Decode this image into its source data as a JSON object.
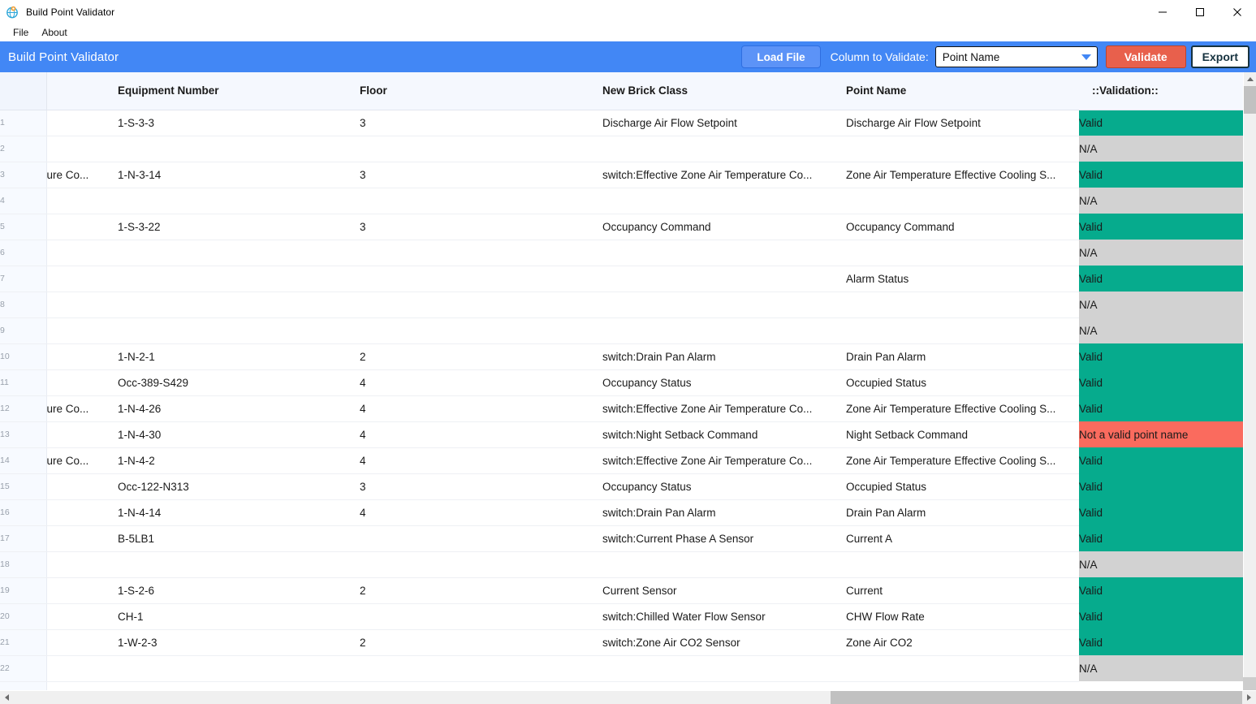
{
  "window": {
    "title": "Build Point Validator",
    "icon": "app-globe-icon",
    "minimize_label": "—",
    "maximize_label": "□",
    "close_label": "✕"
  },
  "menubar": {
    "items": [
      {
        "label": "File"
      },
      {
        "label": "About"
      }
    ]
  },
  "appheader": {
    "title": "Build Point Validator",
    "accent_blue": "#4287f5",
    "load_file_label": "Load File",
    "column_to_validate_label": "Column to Validate:",
    "selected_column": "Point Name",
    "validate_label": "Validate",
    "validate_color": "#e8604c",
    "export_label": "Export"
  },
  "table": {
    "columns": [
      {
        "key": "rownum",
        "label": ""
      },
      {
        "key": "clipped",
        "label": ""
      },
      {
        "key": "equipment_number",
        "label": "Equipment Number"
      },
      {
        "key": "floor",
        "label": "Floor"
      },
      {
        "key": "new_brick_class",
        "label": "New Brick Class"
      },
      {
        "key": "point_name",
        "label": "Point Name"
      },
      {
        "key": "validation",
        "label": "::Validation::"
      }
    ],
    "status_colors": {
      "valid": "#06ab8d",
      "na": "#d2d2d2",
      "invalid": "#fa6b5e"
    },
    "rows": [
      {
        "n": "1",
        "clipped": "",
        "equipment_number": "1-S-3-3",
        "floor": "3",
        "new_brick_class": "Discharge Air Flow Setpoint",
        "point_name": "Discharge Air Flow Setpoint",
        "validation": "Valid",
        "status": "valid"
      },
      {
        "n": "2",
        "clipped": "",
        "equipment_number": "",
        "floor": "",
        "new_brick_class": "",
        "point_name": "",
        "validation": "N/A",
        "status": "na"
      },
      {
        "n": "3",
        "clipped": "ure Co...",
        "equipment_number": "1-N-3-14",
        "floor": "3",
        "new_brick_class": "switch:Effective Zone Air Temperature Co...",
        "point_name": "Zone Air Temperature Effective Cooling S...",
        "validation": "Valid",
        "status": "valid"
      },
      {
        "n": "4",
        "clipped": "",
        "equipment_number": "",
        "floor": "",
        "new_brick_class": "",
        "point_name": "",
        "validation": "N/A",
        "status": "na"
      },
      {
        "n": "5",
        "clipped": "",
        "equipment_number": "1-S-3-22",
        "floor": "3",
        "new_brick_class": "Occupancy Command",
        "point_name": "Occupancy Command",
        "validation": "Valid",
        "status": "valid"
      },
      {
        "n": "6",
        "clipped": "",
        "equipment_number": "",
        "floor": "",
        "new_brick_class": "",
        "point_name": "",
        "validation": "N/A",
        "status": "na"
      },
      {
        "n": "7",
        "clipped": "",
        "equipment_number": "",
        "floor": "",
        "new_brick_class": "",
        "point_name": "Alarm Status",
        "validation": "Valid",
        "status": "valid"
      },
      {
        "n": "8",
        "clipped": "",
        "equipment_number": "",
        "floor": "",
        "new_brick_class": "",
        "point_name": "",
        "validation": "N/A",
        "status": "na"
      },
      {
        "n": "9",
        "clipped": "",
        "equipment_number": "",
        "floor": "",
        "new_brick_class": "",
        "point_name": "",
        "validation": "N/A",
        "status": "na"
      },
      {
        "n": "10",
        "clipped": "",
        "equipment_number": "1-N-2-1",
        "floor": "2",
        "new_brick_class": "switch:Drain Pan Alarm",
        "point_name": "Drain Pan Alarm",
        "validation": "Valid",
        "status": "valid"
      },
      {
        "n": "11",
        "clipped": "",
        "equipment_number": "Occ-389-S429",
        "floor": "4",
        "new_brick_class": "Occupancy Status",
        "point_name": "Occupied Status",
        "validation": "Valid",
        "status": "valid"
      },
      {
        "n": "12",
        "clipped": "ure Co...",
        "equipment_number": "1-N-4-26",
        "floor": "4",
        "new_brick_class": "switch:Effective Zone Air Temperature Co...",
        "point_name": "Zone Air Temperature Effective Cooling S...",
        "validation": "Valid",
        "status": "valid"
      },
      {
        "n": "13",
        "clipped": "",
        "equipment_number": "1-N-4-30",
        "floor": "4",
        "new_brick_class": "switch:Night Setback Command",
        "point_name": "Night Setback Command",
        "validation": "Not a valid point name",
        "status": "invalid"
      },
      {
        "n": "14",
        "clipped": "ure Co...",
        "equipment_number": "1-N-4-2",
        "floor": "4",
        "new_brick_class": "switch:Effective Zone Air Temperature Co...",
        "point_name": "Zone Air Temperature Effective Cooling S...",
        "validation": "Valid",
        "status": "valid"
      },
      {
        "n": "15",
        "clipped": "",
        "equipment_number": "Occ-122-N313",
        "floor": "3",
        "new_brick_class": "Occupancy Status",
        "point_name": "Occupied Status",
        "validation": "Valid",
        "status": "valid"
      },
      {
        "n": "16",
        "clipped": "",
        "equipment_number": "1-N-4-14",
        "floor": "4",
        "new_brick_class": "switch:Drain Pan Alarm",
        "point_name": "Drain Pan Alarm",
        "validation": "Valid",
        "status": "valid"
      },
      {
        "n": "17",
        "clipped": "",
        "equipment_number": "B-5LB1",
        "floor": "",
        "new_brick_class": "switch:Current Phase A Sensor",
        "point_name": "Current A",
        "validation": "Valid",
        "status": "valid"
      },
      {
        "n": "18",
        "clipped": "",
        "equipment_number": "",
        "floor": "",
        "new_brick_class": "",
        "point_name": "",
        "validation": "N/A",
        "status": "na"
      },
      {
        "n": "19",
        "clipped": "",
        "equipment_number": "1-S-2-6",
        "floor": "2",
        "new_brick_class": "Current Sensor",
        "point_name": "Current",
        "validation": "Valid",
        "status": "valid"
      },
      {
        "n": "20",
        "clipped": "",
        "equipment_number": "CH-1",
        "floor": "",
        "new_brick_class": "switch:Chilled Water Flow Sensor",
        "point_name": "CHW Flow Rate",
        "validation": "Valid",
        "status": "valid"
      },
      {
        "n": "21",
        "clipped": "",
        "equipment_number": "1-W-2-3",
        "floor": "2",
        "new_brick_class": "switch:Zone Air CO2 Sensor",
        "point_name": "Zone Air CO2",
        "validation": "Valid",
        "status": "valid"
      },
      {
        "n": "22",
        "clipped": "",
        "equipment_number": "",
        "floor": "",
        "new_brick_class": "",
        "point_name": "",
        "validation": "N/A",
        "status": "na"
      },
      {
        "n": "",
        "clipped": "",
        "equipment_number": "",
        "floor": "",
        "new_brick_class": "",
        "point_name": "",
        "validation": "",
        "status": "blank"
      }
    ]
  },
  "scrollbars": {
    "vertical_thumb_percent": 4,
    "horizontal_thumb_percent": 33
  }
}
